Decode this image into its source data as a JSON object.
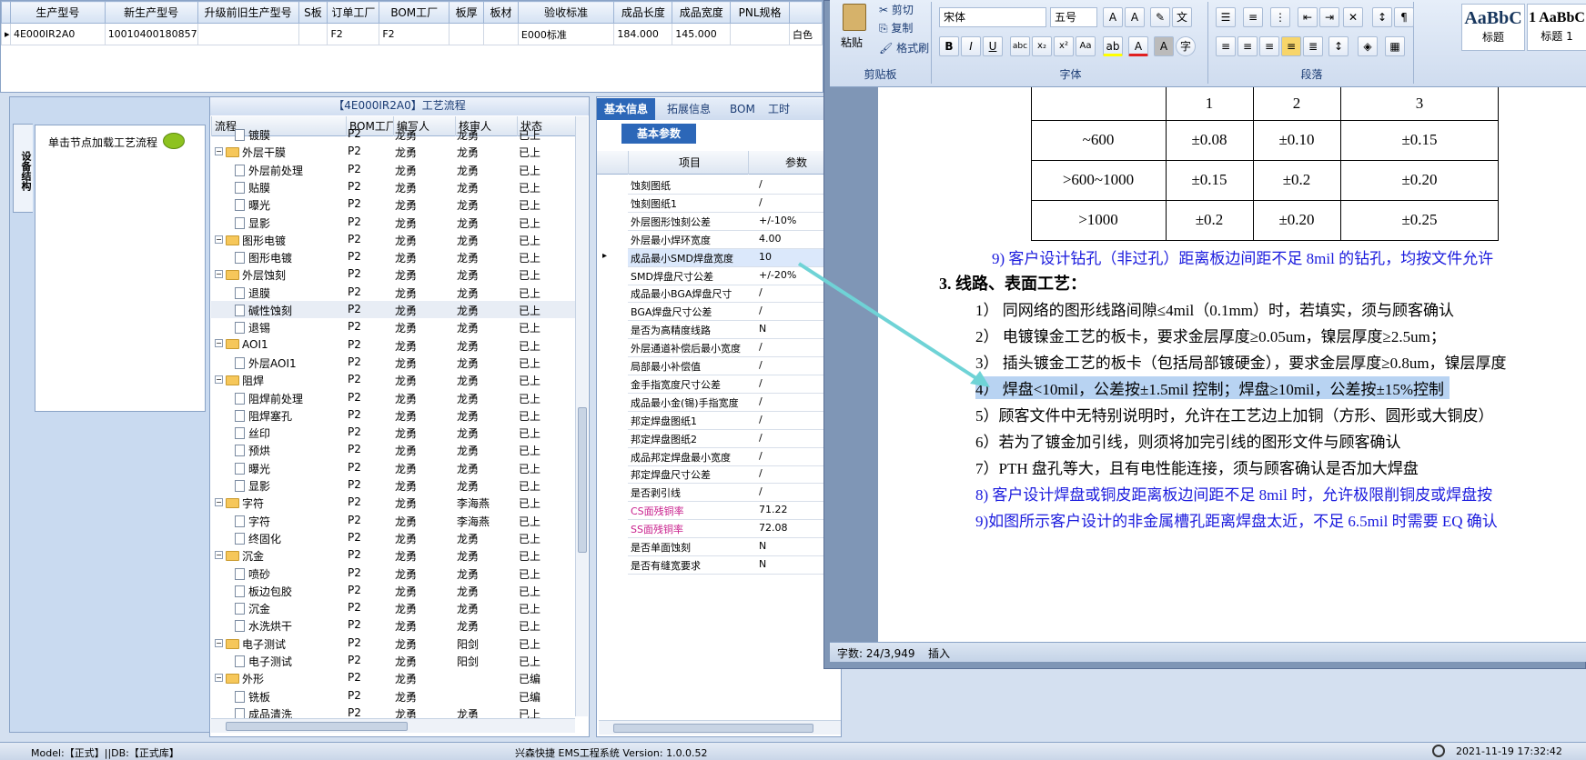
{
  "top_grid": {
    "headers": [
      "生产型号",
      "新生产型号",
      "升级前旧生产型号",
      "S板",
      "订单工厂",
      "BOM工厂",
      "板厚",
      "板材",
      "验收标准",
      "成品长度",
      "成品宽度",
      "PNL规格"
    ],
    "row": [
      "4E000IR2A0",
      "10010400180857",
      "",
      "",
      "F2",
      "F2",
      "",
      "",
      "E000标准",
      "184.000",
      "145.000",
      ""
    ],
    "last_cell": "白色"
  },
  "left_panel": {
    "tab_label": "设备结构",
    "node_hint": "单击节点加载工艺流程"
  },
  "tree_panel": {
    "title": "【4E000IR2A0】工艺流程",
    "columns": [
      "流程",
      "BOM工厂",
      "编写人",
      "核审人",
      "状态"
    ],
    "rows": [
      {
        "name": "镀膜",
        "level": 2,
        "type": "doc",
        "bom": "P2",
        "writer": "龙勇",
        "reviewer": "龙勇",
        "status": "已上"
      },
      {
        "name": "外层干膜",
        "level": 1,
        "type": "folder",
        "bom": "P2",
        "writer": "龙勇",
        "reviewer": "龙勇",
        "status": "已上"
      },
      {
        "name": "外层前处理",
        "level": 2,
        "type": "doc",
        "bom": "P2",
        "writer": "龙勇",
        "reviewer": "龙勇",
        "status": "已上"
      },
      {
        "name": "贴膜",
        "level": 2,
        "type": "doc",
        "bom": "P2",
        "writer": "龙勇",
        "reviewer": "龙勇",
        "status": "已上"
      },
      {
        "name": "曝光",
        "level": 2,
        "type": "doc",
        "bom": "P2",
        "writer": "龙勇",
        "reviewer": "龙勇",
        "status": "已上"
      },
      {
        "name": "显影",
        "level": 2,
        "type": "doc",
        "bom": "P2",
        "writer": "龙勇",
        "reviewer": "龙勇",
        "status": "已上"
      },
      {
        "name": "图形电镀",
        "level": 1,
        "type": "folder",
        "bom": "P2",
        "writer": "龙勇",
        "reviewer": "龙勇",
        "status": "已上"
      },
      {
        "name": "图形电镀",
        "level": 2,
        "type": "doc",
        "bom": "P2",
        "writer": "龙勇",
        "reviewer": "龙勇",
        "status": "已上"
      },
      {
        "name": "外层蚀刻",
        "level": 1,
        "type": "folder",
        "bom": "P2",
        "writer": "龙勇",
        "reviewer": "龙勇",
        "status": "已上"
      },
      {
        "name": "退膜",
        "level": 2,
        "type": "doc",
        "bom": "P2",
        "writer": "龙勇",
        "reviewer": "龙勇",
        "status": "已上"
      },
      {
        "name": "碱性蚀刻",
        "level": 2,
        "type": "doc",
        "bom": "P2",
        "writer": "龙勇",
        "reviewer": "龙勇",
        "status": "已上"
      },
      {
        "name": "退锡",
        "level": 2,
        "type": "doc",
        "bom": "P2",
        "writer": "龙勇",
        "reviewer": "龙勇",
        "status": "已上"
      },
      {
        "name": "AOI1",
        "level": 1,
        "type": "folder",
        "bom": "P2",
        "writer": "龙勇",
        "reviewer": "龙勇",
        "status": "已上"
      },
      {
        "name": "外层AOI1",
        "level": 2,
        "type": "doc",
        "bom": "P2",
        "writer": "龙勇",
        "reviewer": "龙勇",
        "status": "已上"
      },
      {
        "name": "阻焊",
        "level": 1,
        "type": "folder",
        "bom": "P2",
        "writer": "龙勇",
        "reviewer": "龙勇",
        "status": "已上"
      },
      {
        "name": "阻焊前处理",
        "level": 2,
        "type": "doc",
        "bom": "P2",
        "writer": "龙勇",
        "reviewer": "龙勇",
        "status": "已上"
      },
      {
        "name": "阻焊塞孔",
        "level": 2,
        "type": "doc",
        "bom": "P2",
        "writer": "龙勇",
        "reviewer": "龙勇",
        "status": "已上"
      },
      {
        "name": "丝印",
        "level": 2,
        "type": "doc",
        "bom": "P2",
        "writer": "龙勇",
        "reviewer": "龙勇",
        "status": "已上"
      },
      {
        "name": "预烘",
        "level": 2,
        "type": "doc",
        "bom": "P2",
        "writer": "龙勇",
        "reviewer": "龙勇",
        "status": "已上"
      },
      {
        "name": "曝光",
        "level": 2,
        "type": "doc",
        "bom": "P2",
        "writer": "龙勇",
        "reviewer": "龙勇",
        "status": "已上"
      },
      {
        "name": "显影",
        "level": 2,
        "type": "doc",
        "bom": "P2",
        "writer": "龙勇",
        "reviewer": "龙勇",
        "status": "已上"
      },
      {
        "name": "字符",
        "level": 1,
        "type": "folder",
        "bom": "P2",
        "writer": "龙勇",
        "reviewer": "李海燕",
        "status": "已上"
      },
      {
        "name": "字符",
        "level": 2,
        "type": "doc",
        "bom": "P2",
        "writer": "龙勇",
        "reviewer": "李海燕",
        "status": "已上"
      },
      {
        "name": "终固化",
        "level": 2,
        "type": "doc",
        "bom": "P2",
        "writer": "龙勇",
        "reviewer": "龙勇",
        "status": "已上"
      },
      {
        "name": "沉金",
        "level": 1,
        "type": "folder",
        "bom": "P2",
        "writer": "龙勇",
        "reviewer": "龙勇",
        "status": "已上"
      },
      {
        "name": "喷砂",
        "level": 2,
        "type": "doc",
        "bom": "P2",
        "writer": "龙勇",
        "reviewer": "龙勇",
        "status": "已上"
      },
      {
        "name": "板边包胶",
        "level": 2,
        "type": "doc",
        "bom": "P2",
        "writer": "龙勇",
        "reviewer": "龙勇",
        "status": "已上"
      },
      {
        "name": "沉金",
        "level": 2,
        "type": "doc",
        "bom": "P2",
        "writer": "龙勇",
        "reviewer": "龙勇",
        "status": "已上"
      },
      {
        "name": "水洗烘干",
        "level": 2,
        "type": "doc",
        "bom": "P2",
        "writer": "龙勇",
        "reviewer": "龙勇",
        "status": "已上"
      },
      {
        "name": "电子测试",
        "level": 1,
        "type": "folder",
        "bom": "P2",
        "writer": "龙勇",
        "reviewer": "阳剑",
        "status": "已上"
      },
      {
        "name": "电子测试",
        "level": 2,
        "type": "doc",
        "bom": "P2",
        "writer": "龙勇",
        "reviewer": "阳剑",
        "status": "已上"
      },
      {
        "name": "外形",
        "level": 1,
        "type": "folder",
        "bom": "P2",
        "writer": "龙勇",
        "reviewer": "",
        "status": "已编"
      },
      {
        "name": "铣板",
        "level": 2,
        "type": "doc",
        "bom": "P2",
        "writer": "龙勇",
        "reviewer": "",
        "status": "已编"
      },
      {
        "name": "成品清洗",
        "level": 2,
        "type": "doc",
        "bom": "P2",
        "writer": "龙勇",
        "reviewer": "龙勇",
        "status": "已上"
      }
    ]
  },
  "prop_panel": {
    "tabs": [
      "基本信息",
      "拓展信息",
      "BOM",
      "工时"
    ],
    "sub_tab": "基本参数",
    "columns": [
      "项目",
      "参数"
    ],
    "rows": [
      {
        "k": "蚀刻图纸",
        "v": "/"
      },
      {
        "k": "蚀刻图纸1",
        "v": "/"
      },
      {
        "k": "外层图形蚀刻公差",
        "v": "+/-10%"
      },
      {
        "k": "外层最小焊环宽度",
        "v": "4.00"
      },
      {
        "k": "成品最小SMD焊盘宽度",
        "v": "10",
        "selected": true
      },
      {
        "k": "SMD焊盘尺寸公差",
        "v": "+/-20%"
      },
      {
        "k": "成品最小BGA焊盘尺寸",
        "v": "/"
      },
      {
        "k": "BGA焊盘尺寸公差",
        "v": "/"
      },
      {
        "k": "是否为高精度线路",
        "v": "N"
      },
      {
        "k": "外层通道补偿后最小宽度",
        "v": "/"
      },
      {
        "k": "局部最小补偿值",
        "v": "/"
      },
      {
        "k": "金手指宽度尺寸公差",
        "v": "/"
      },
      {
        "k": "成品最小金(锡)手指宽度",
        "v": "/"
      },
      {
        "k": "邦定焊盘图纸1",
        "v": "/"
      },
      {
        "k": "邦定焊盘图纸2",
        "v": "/"
      },
      {
        "k": "成品邦定焊盘最小宽度",
        "v": "/"
      },
      {
        "k": "邦定焊盘尺寸公差",
        "v": "/"
      },
      {
        "k": "是否剥引线",
        "v": "/"
      },
      {
        "k": "CS面残铜率",
        "v": "71.22",
        "pink": true
      },
      {
        "k": "SS面残铜率",
        "v": "72.08",
        "pink": true
      },
      {
        "k": "是否单面蚀刻",
        "v": "N"
      },
      {
        "k": "是否有缝宽要求",
        "v": "N"
      }
    ]
  },
  "word": {
    "clipboard": {
      "paste": "粘贴",
      "cut": "剪切",
      "copy": "复制",
      "format_painter": "格式刷",
      "label": "剪贴板"
    },
    "font": {
      "name": "宋体",
      "size": "五号",
      "label": "字体"
    },
    "paragraph_label": "段落",
    "styles": [
      {
        "sample": "AaBbC",
        "name": "标题"
      },
      {
        "sample": "1 AaBbC",
        "name": "标题 1"
      }
    ],
    "table": {
      "header": [
        "1",
        "2",
        "3"
      ],
      "rows": [
        [
          "~600",
          "±0.08",
          "±0.10",
          "±0.15"
        ],
        [
          ">600~1000",
          "±0.15",
          "±0.2",
          "±0.20"
        ],
        [
          ">1000",
          "±0.2",
          "±0.20",
          "±0.25"
        ]
      ]
    },
    "lines": {
      "l9a": "9) 客户设计钻孔（非过孔）距离板边间距不足 8mil 的钻孔，均按文件允许",
      "h3": "3.  线路、表面工艺：",
      "l1": "1） 同网络的图形线路间隙≤4mil（0.1mm）时，若填实，须与顾客确认",
      "l2": "2） 电镀镍金工艺的板卡，要求金层厚度≥0.05um，镍层厚度≥2.5um；",
      "l3": "3） 插头镀金工艺的板卡（包括局部镀硬金），要求金层厚度≥0.8um，镍层厚度",
      "l4": "4） 焊盘<10mil，公差按±1.5mil 控制；焊盘≥10mil，公差按±15%控制",
      "l5": "5）顾客文件中无特别说明时，允许在工艺边上加铜（方形、圆形或大铜皮）",
      "l6": "6）若为了镀金加引线，则须将加完引线的图形文件与顾客确认",
      "l7": "7）PTH 盘孔等大，且有电性能连接，须与顾客确认是否加大焊盘",
      "l8": "8) 客户设计焊盘或铜皮距离板边间距不足 8mil 时，允许极限削铜皮或焊盘按",
      "l9b": "9)如图所示客户设计的非金属槽孔距离焊盘太近，不足 6.5mil 时需要 EQ 确认"
    },
    "status": {
      "word_count": "字数: 24/3,949",
      "mode": "插入"
    }
  },
  "bottom_bar": {
    "left": "Model:【正式】||DB:【正式库】",
    "center": "兴森快捷 EMS工程系统 Version: 1.0.0.52",
    "right": "2021-11-19 17:32:42"
  },
  "colors": {
    "arrow": "#6fd3d6",
    "highlight": "#b8d3f2",
    "pink": "#c81e8c",
    "blue_text": "#1a1add"
  }
}
